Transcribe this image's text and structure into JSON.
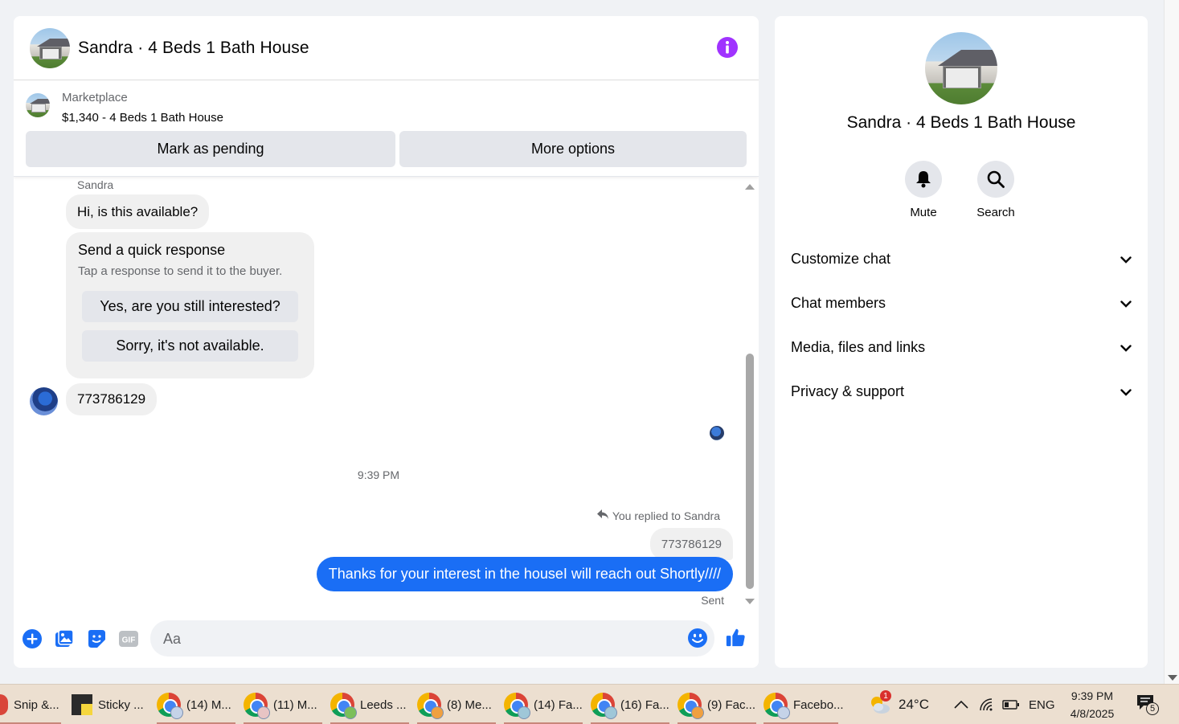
{
  "chat": {
    "title": "Sandra · 4 Beds 1 Bath House",
    "listing_category": "Marketplace",
    "listing_title": "$1,340 - 4 Beds 1 Bath House",
    "mark_pending_label": "Mark as pending",
    "more_options_label": "More options"
  },
  "messages": {
    "sender_name": "Sandra",
    "first_message": "Hi, is this available?",
    "quick_title": "Send a quick response",
    "quick_subtitle": "Tap a response to send it to the buyer.",
    "quick_option_1": "Yes, are you still interested?",
    "quick_option_2": "Sorry, it's not available.",
    "second_message": "773786129",
    "timestamp": "9:39 PM",
    "replied_label": "You replied to Sandra",
    "quoted_text": "773786129",
    "outgoing_message": "Thanks for your interest in the houseI will reach out Shortly////",
    "status": "Sent"
  },
  "composer": {
    "placeholder": "Aa",
    "gif_label": "GIF"
  },
  "info_panel": {
    "name": "Sandra · 4 Beds 1 Bath House",
    "mute_label": "Mute",
    "search_label": "Search",
    "sections": [
      "Customize chat",
      "Chat members",
      "Media, files and links",
      "Privacy & support"
    ]
  },
  "taskbar": {
    "apps": [
      {
        "label": "Snip &...",
        "icon": "snip-icon"
      },
      {
        "label": "Sticky ...",
        "icon": "sticky-notes-icon"
      },
      {
        "label": "(14) M...",
        "icon": "chrome-icon"
      },
      {
        "label": "(11) M...",
        "icon": "chrome-icon"
      },
      {
        "label": "Leeds ...",
        "icon": "chrome-icon"
      },
      {
        "label": "(8) Me...",
        "icon": "chrome-icon"
      },
      {
        "label": "(14) Fa...",
        "icon": "chrome-icon"
      },
      {
        "label": "(16) Fa...",
        "icon": "chrome-icon"
      },
      {
        "label": "(9) Fac...",
        "icon": "chrome-icon"
      },
      {
        "label": "Facebo...",
        "icon": "chrome-icon"
      }
    ],
    "weather_badge": "1",
    "temperature": "24°C",
    "language": "ENG",
    "time": "9:39 PM",
    "date": "4/8/2025",
    "notification_count": "5"
  },
  "colors": {
    "accent_blue": "#1a6ef5",
    "info_purple": "#a033ff",
    "taskbar_bg": "#ecdfd0"
  }
}
